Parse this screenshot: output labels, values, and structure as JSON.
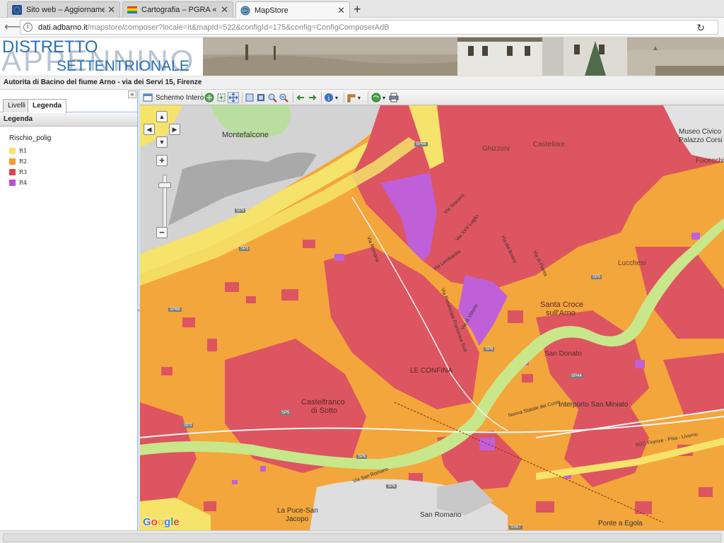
{
  "browser": {
    "tabs": [
      {
        "title": "Sito web – Aggiornament...",
        "favicon": "eu-flag-icon",
        "active": false
      },
      {
        "title": "Cartografia – PGRA « Auto...",
        "favicon": "rainbow-icon",
        "active": false
      },
      {
        "title": "MapStore",
        "favicon": "globe-icon",
        "active": true
      }
    ],
    "new_tab_label": "+",
    "close_label": "✕",
    "url_host": "dati.adbarno.it",
    "url_rest": "/mapstore/composer?locale=it&mapId=522&configId=175&config=ConfigComposerAdB"
  },
  "header": {
    "logo_line1": "DISTRETTO",
    "logo_line2": "APPENNINO",
    "logo_line3": "SETTENTRIONALE"
  },
  "app": {
    "title": "Autorita di Bacino del fiume Arno - via dei Servi 15, Firenze"
  },
  "left_panel": {
    "collapse_label": "«",
    "tabs": [
      {
        "label": "Livelli",
        "active": false
      },
      {
        "label": "Legenda",
        "active": true
      }
    ],
    "legend_header": "Legenda",
    "layer_name": "Rischio_polig",
    "legend_items": [
      {
        "label": "R1",
        "color": "#f5e36b"
      },
      {
        "label": "R2",
        "color": "#f39c2b"
      },
      {
        "label": "R3",
        "color": "#d94452"
      },
      {
        "label": "R4",
        "color": "#b553cf"
      }
    ]
  },
  "toolbar": {
    "fullscreen_label": "Schermo Intero"
  },
  "map": {
    "colors": {
      "r1": "#f5e36b",
      "r2": "#f3a63b",
      "r3": "#dd5560",
      "r4": "#c060d8",
      "river": "#c8e68a",
      "base_grey": "#cfcfcf",
      "hill": "#a8a8a8",
      "green": "#bfe0a4"
    },
    "places": [
      {
        "text": "Montefalcone"
      },
      {
        "text": "Ghizzoni"
      },
      {
        "text": "Castellare"
      },
      {
        "text": "Museo Civico"
      },
      {
        "text": "Palazzo Corsi"
      },
      {
        "text": "Fucecchio"
      },
      {
        "text": "Lucchesi"
      },
      {
        "text": "Santa Croce"
      },
      {
        "text": "sull'Arno"
      },
      {
        "text": "San Donato"
      },
      {
        "text": "LE CONFINA"
      },
      {
        "text": "Interporto San Miniato"
      },
      {
        "text": "Castelfranco"
      },
      {
        "text": "di Sotto"
      },
      {
        "text": "La Puce-San"
      },
      {
        "text": "Jacopo"
      },
      {
        "text": "San Romano"
      },
      {
        "text": "Ponte a Egola"
      }
    ],
    "road_shields": [
      "SP66",
      "SP5",
      "SP3",
      "SP66",
      "SP5",
      "SP6",
      "SP3",
      "SP44",
      "SP5",
      "SP6",
      "SP6",
      "SS67"
    ],
    "street_labels": [
      "Via Toscana",
      "Via XXV Luglio",
      "Via Lombardia",
      "Nuova Statale del Cuoio",
      "Via Romana",
      "Via di Vittorio",
      "Via Provinciale Francesca Sud",
      "Via del Bosco",
      "Via di Pianta",
      "SGC Firenze - Pisa - Livorno",
      "Via San Romano"
    ],
    "attribution": "Google"
  }
}
